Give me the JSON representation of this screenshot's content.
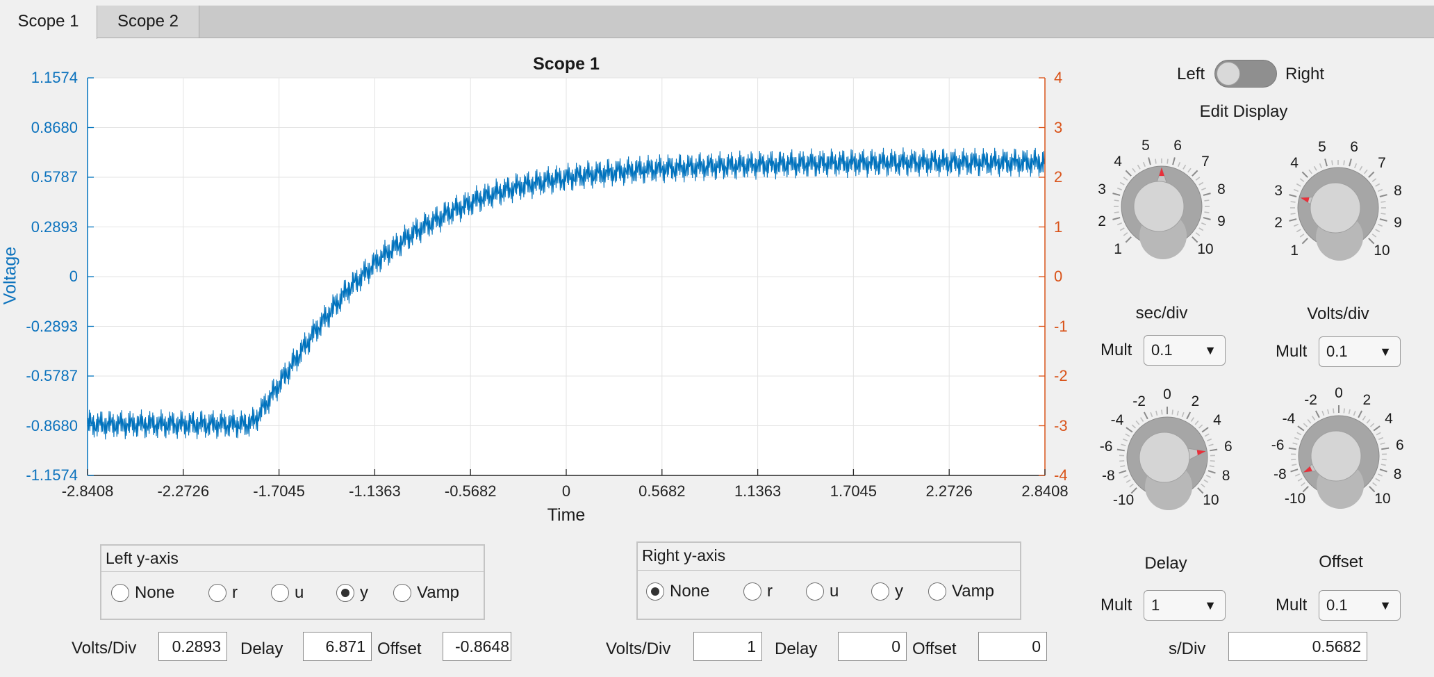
{
  "tabs": [
    {
      "label": "Scope 1",
      "active": true
    },
    {
      "label": "Scope 2",
      "active": false
    }
  ],
  "chart_data": {
    "type": "line",
    "title": "Scope 1",
    "xlabel": "Time",
    "ylabel_left": "Voltage",
    "ylabel_right": "",
    "x_ticks": [
      "-2.8408",
      "-2.2726",
      "-1.7045",
      "-1.1363",
      "-0.5682",
      "0",
      "0.5682",
      "1.1363",
      "1.7045",
      "2.2726",
      "2.8408"
    ],
    "y_left_ticks": [
      "1.1574",
      "0.8680",
      "0.5787",
      "0.2893",
      "0",
      "-0.2893",
      "-0.5787",
      "-0.8680",
      "-1.1574"
    ],
    "y_right_ticks": [
      "4",
      "3",
      "2",
      "1",
      "0",
      "-1",
      "-2",
      "-3",
      "-4"
    ],
    "xlim": [
      -2.8408,
      2.8408
    ],
    "ylim_left": [
      -1.1574,
      1.1574
    ],
    "ylim_right": [
      -4,
      4
    ],
    "grid": true,
    "series": [
      {
        "color": "#0072bd",
        "x": [
          -2.8408,
          -2.5,
          -2.2,
          -1.9,
          -1.85,
          -1.7,
          -1.5,
          -1.3,
          -1.1,
          -0.9,
          -0.7,
          -0.5,
          -0.3,
          -0.1,
          0.1,
          0.3,
          0.5,
          0.8,
          1.1,
          1.5,
          2.0,
          2.5,
          2.8408
        ],
        "y": [
          -0.86,
          -0.86,
          -0.86,
          -0.86,
          -0.84,
          -0.62,
          -0.33,
          -0.08,
          0.11,
          0.26,
          0.37,
          0.46,
          0.52,
          0.56,
          0.59,
          0.61,
          0.625,
          0.64,
          0.65,
          0.66,
          0.665,
          0.665,
          0.665
        ],
        "ripple_amplitude": 0.13
      }
    ]
  },
  "controls": {
    "toggle": {
      "left_label": "Left",
      "right_label": "Right",
      "state": "Left"
    },
    "edit_display": "Edit Display",
    "knob_sec": {
      "labels": [
        "1",
        "2",
        "3",
        "4",
        "5",
        "6",
        "7",
        "8",
        "9",
        "10"
      ],
      "value": 5.5
    },
    "knob_volts": {
      "labels": [
        "1",
        "2",
        "3",
        "4",
        "5",
        "6",
        "7",
        "8",
        "9",
        "10"
      ],
      "value": 3
    },
    "knob_delay": {
      "labels": [
        "-10",
        "-8",
        "-6",
        "-4",
        "-2",
        "0",
        "2",
        "4",
        "6",
        "8",
        "10"
      ],
      "value": 6
    },
    "knob_offset": {
      "labels": [
        "-10",
        "-8",
        "-6",
        "-4",
        "-2",
        "0",
        "2",
        "4",
        "6",
        "8",
        "10"
      ],
      "value": -8.5
    },
    "sec_div_label": "sec/div",
    "volts_div_label": "Volts/div",
    "delay_label": "Delay",
    "offset_label": "Offset",
    "mult_label": "Mult",
    "mult_sec": "0.1",
    "mult_volts": "0.1",
    "mult_delay": "1",
    "mult_offset": "0.1",
    "s_div_label": "s/Div",
    "s_div_value": "0.5682"
  },
  "left_axis": {
    "title": "Left y-axis",
    "options": [
      "None",
      "r",
      "u",
      "y",
      "Vamp"
    ],
    "selected": "y",
    "volts_div_label": "Volts/Div",
    "volts_div": "0.2893",
    "delay_label": "Delay",
    "delay": "6.871",
    "offset_label": "Offset",
    "offset": "-0.8648"
  },
  "right_axis": {
    "title": "Right y-axis",
    "options": [
      "None",
      "r",
      "u",
      "y",
      "Vamp"
    ],
    "selected": "None",
    "volts_div_label": "Volts/Div",
    "volts_div": "1",
    "delay_label": "Delay",
    "delay": "0",
    "offset_label": "Offset",
    "offset": "0"
  },
  "colors": {
    "left_axis": "#0072bd",
    "right_axis": "#d95319",
    "trace": "#0072bd",
    "knob_pointer": "#e8303a"
  }
}
